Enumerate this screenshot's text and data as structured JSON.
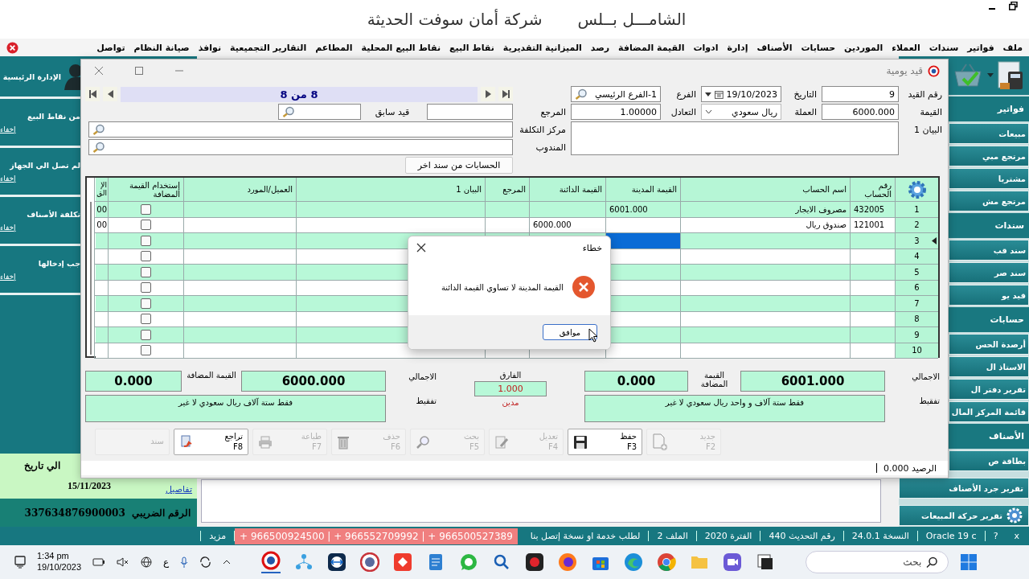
{
  "app_title": {
    "product": "الشامـــل بــلس",
    "company": "شركة أمان سوفت الحديثة"
  },
  "menu": [
    "ملف",
    "فواتير",
    "سندات",
    "العملاء",
    "الموردين",
    "حسابات",
    "الأصناف",
    "إدارة",
    "ادوات",
    "القيمة المضافة",
    "رصد",
    "الميزانية التقديرية",
    "نقاط البيع",
    "نقاط البيع المحلية",
    "المطاعم",
    "التقارير التجميعية",
    "نوافذ",
    "صيانة النظام",
    "تواصل"
  ],
  "left_panel": {
    "header": "الإدارة الرئيسية",
    "notices": [
      {
        "text": "من نقاط البيع",
        "link": "إخفاء"
      },
      {
        "text": "لم تصل الي الجهاز",
        "link": "إخفاء"
      },
      {
        "text": "تكلفة الأصناف",
        "link": "إخفاء"
      },
      {
        "text": "جب إدخالها",
        "link": "إخفاء"
      }
    ],
    "date_label": "الي تاريخ",
    "date": "15/11/2023",
    "details_link": "تفاصيل",
    "tax_label": "الرقم الضريبي",
    "tax_number": "337634876900003"
  },
  "right_sidebar": [
    {
      "kind": "header",
      "label": "فواتير"
    },
    {
      "kind": "item",
      "label": "مبيعات"
    },
    {
      "kind": "item",
      "label": "مرتجع مبي"
    },
    {
      "kind": "item",
      "label": "مشتريا"
    },
    {
      "kind": "item",
      "label": "مرتجع مش"
    },
    {
      "kind": "header",
      "label": "سندات"
    },
    {
      "kind": "item",
      "label": "سند قب"
    },
    {
      "kind": "item",
      "label": "سند صر"
    },
    {
      "kind": "item",
      "label": "قيد يو"
    },
    {
      "kind": "header",
      "label": "حسابات"
    },
    {
      "kind": "item",
      "label": "أرصدة الحس"
    },
    {
      "kind": "item",
      "label": "الاستاذ ال"
    },
    {
      "kind": "item",
      "label": "تقرير دفتر ال"
    },
    {
      "kind": "item",
      "label": "قائمة المركز المال"
    },
    {
      "kind": "header",
      "label": "الأصناف"
    },
    {
      "kind": "item",
      "label": "بطاقة ص"
    },
    {
      "kind": "wide_item",
      "label": "تقرير جرد  الأصناف"
    },
    {
      "kind": "wide_gear_item",
      "label": "تقرير حركة المبيعات"
    }
  ],
  "window": {
    "title": "قيد يومية",
    "form": {
      "entry_no": {
        "label": "رقم القيد",
        "value": "9"
      },
      "date": {
        "label": "التاريخ",
        "value": "19/10/2023"
      },
      "branch": {
        "label": "الفرع",
        "value": "1-الفرع الرئيسي"
      },
      "amount": {
        "label": "القيمة",
        "value": "6000.000"
      },
      "currency": {
        "label": "العملة",
        "value": "ريال سعودي"
      },
      "rate": {
        "label": "التعادل",
        "value": "1.00000"
      },
      "reference": {
        "label": "المرجع"
      },
      "previous_entry": {
        "label": "قيد سابق"
      },
      "description": {
        "label": "البيان 1"
      },
      "cost_center": {
        "label": "مركز التكلفة"
      },
      "representative": {
        "label": "المندوب"
      }
    },
    "record_position": "8  من  8",
    "copy_button": "الحسابات من سند اخر",
    "table": {
      "columns": [
        "رقم الحساب",
        "اسم الحساب",
        "القيمة المدينة",
        "القيمة الدائنة",
        "المرجع",
        "البيان 1",
        "العميل/المورد",
        "إستخدام القيمة المضافة",
        "الإ الق"
      ],
      "rows": [
        {
          "no": "1",
          "account": "432005",
          "name": "مصروف الايجار",
          "debit": "6001.000",
          "vat": false,
          "column_10": "00",
          "current": false
        },
        {
          "no": "2",
          "account": "121001",
          "name": "صندوق ريال",
          "credit": "6000.000",
          "vat": false,
          "column_10": "00",
          "current": false
        },
        {
          "no": "3",
          "vat": false,
          "current": true
        },
        {
          "no": "4",
          "vat": false,
          "current": false
        },
        {
          "no": "5",
          "vat": false,
          "current": false
        },
        {
          "no": "6",
          "vat": false,
          "current": false
        },
        {
          "no": "7",
          "vat": false,
          "current": false
        },
        {
          "no": "8",
          "vat": false,
          "current": false
        },
        {
          "no": "9",
          "vat": false,
          "current": false
        },
        {
          "no": "10",
          "vat": false,
          "current": false
        }
      ]
    },
    "totals": {
      "debit_total": {
        "label": "الاجمالي",
        "value": "6001.000"
      },
      "debit_vat": {
        "label": "القيمة المضافة",
        "value": "0.000"
      },
      "debit_words": {
        "label": "تفقيط",
        "value": "فقط ستة آلاف و واحد ريال سعودي لا غير"
      },
      "difference": {
        "label": "الفارق",
        "value": "1.000",
        "side": "مدين"
      },
      "credit_total": {
        "label": "الاجمالي",
        "value": "6000.000"
      },
      "credit_vat": {
        "label": "القيمة المضافة",
        "value": "0.000"
      },
      "credit_words": {
        "label": "تفقيط",
        "value": "فقط ستة آلاف ريال سعودي لا غير"
      }
    },
    "toolbar": [
      {
        "kind": "new",
        "label": "جديد",
        "key": "F2",
        "disabled": true
      },
      {
        "kind": "save",
        "label": "حفظ",
        "key": "F3",
        "disabled": false
      },
      {
        "kind": "edit",
        "label": "تعديل",
        "key": "F4",
        "disabled": true
      },
      {
        "kind": "search",
        "label": "بحث",
        "key": "F5",
        "disabled": true
      },
      {
        "kind": "delete",
        "label": "حذف",
        "key": "F6",
        "disabled": true
      },
      {
        "kind": "print",
        "label": "طباعة",
        "key": "F7",
        "disabled": true
      },
      {
        "kind": "undo",
        "label": "تراجع",
        "key": "F8",
        "disabled": false
      },
      {
        "kind": "plain",
        "label": "سند",
        "disabled": true
      }
    ],
    "balance": "الرصيد 0.000",
    "error_dialog": {
      "title": "خطاء",
      "message": "القيمة المدينة  لا تساوي القيمة الدائنة",
      "button": "موافق"
    }
  },
  "status_bar": {
    "close": "x",
    "help": "?",
    "items": [
      "Oracle 19 c",
      "النسخة  24.0.1",
      "رقم التحديث  440",
      "الفترة 2020",
      "الملف 2",
      "لطلب خدمة او نسخة إتصل بنا"
    ],
    "phones": "+ 966500924500 | + 966552709992 | + 966500527389",
    "more": "مزيد"
  },
  "taskbar": {
    "time": "1:34 pm",
    "date": "19/10/2023",
    "language": "ع",
    "search_placeholder": "بحث"
  }
}
